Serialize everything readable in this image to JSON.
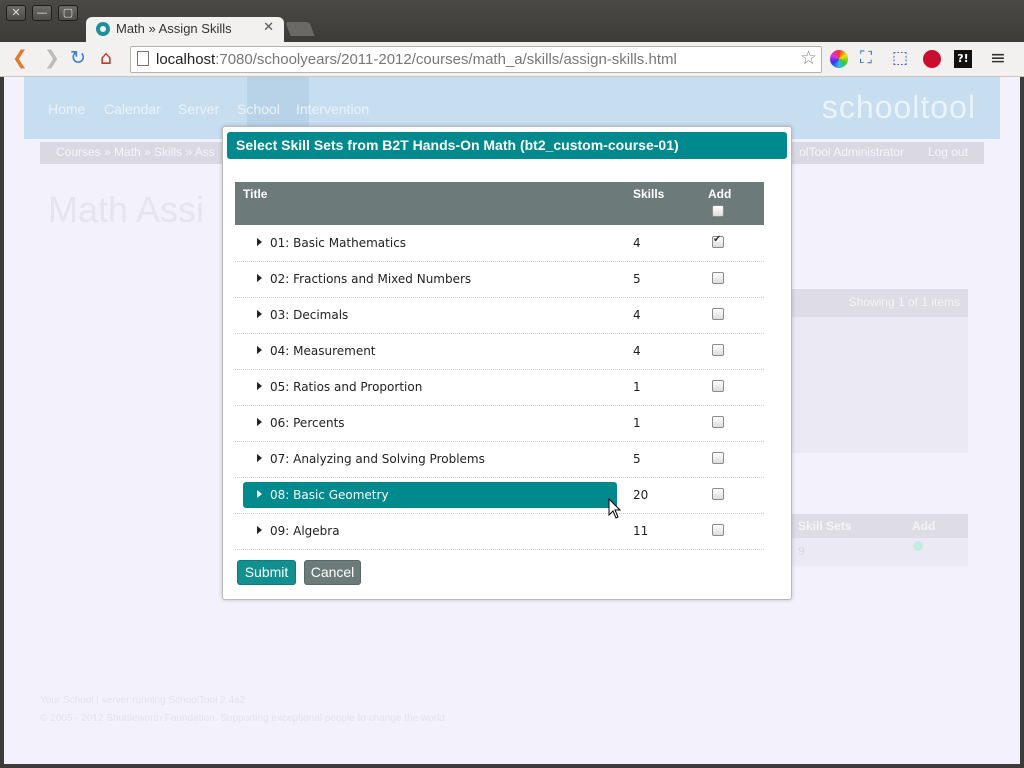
{
  "window": {
    "buttons": [
      "✕",
      "—",
      "▢"
    ]
  },
  "tab": {
    "title": "Math » Assign Skills",
    "close": "✕"
  },
  "toolbar": {
    "url_host": "localhost",
    "url_rest": ":7080/schoolyears/2011-2012/courses/math_a/skills/assign-skills.html"
  },
  "header": {
    "nav": [
      "Home",
      "Calendar",
      "Server",
      "School",
      "Intervention"
    ],
    "logo": "schooltool"
  },
  "breadcrumb": {
    "text": "Courses » Math » Skills » Ass",
    "user": "olTool Administrator",
    "logout": "Log out"
  },
  "page": {
    "title": "Math  Assi",
    "showing": "Showing 1 of 1 items",
    "bg_table_headers": [
      "Skill Sets",
      "Add"
    ],
    "bg_table_value": "9"
  },
  "footer": {
    "line1": "Your School | server running SchoolTool 2.4a2",
    "line2": "© 2005 - 2012 Shuttleworth Foundation. Supporting exceptional people to change the world."
  },
  "modal": {
    "title": "Select Skill Sets from B2T Hands-On Math (bt2_custom-course-01)",
    "columns": {
      "title": "Title",
      "skills": "Skills",
      "add": "Add"
    },
    "rows": [
      {
        "title": "01: Basic Mathematics",
        "skills": "4",
        "checked": true,
        "selected": false
      },
      {
        "title": "02: Fractions and Mixed Numbers",
        "skills": "5",
        "checked": false,
        "selected": false
      },
      {
        "title": "03: Decimals",
        "skills": "4",
        "checked": false,
        "selected": false
      },
      {
        "title": "04: Measurement",
        "skills": "4",
        "checked": false,
        "selected": false
      },
      {
        "title": "05: Ratios and Proportion",
        "skills": "1",
        "checked": false,
        "selected": false
      },
      {
        "title": "06: Percents",
        "skills": "1",
        "checked": false,
        "selected": false
      },
      {
        "title": "07: Analyzing and Solving Problems",
        "skills": "5",
        "checked": false,
        "selected": false
      },
      {
        "title": "08: Basic Geometry",
        "skills": "20",
        "checked": false,
        "selected": true
      },
      {
        "title": "09: Algebra",
        "skills": "11",
        "checked": false,
        "selected": false
      }
    ],
    "submit": "Submit",
    "cancel": "Cancel"
  },
  "colors": {
    "accent_teal": "#008a8d",
    "header_gray": "#6c7b7a"
  }
}
